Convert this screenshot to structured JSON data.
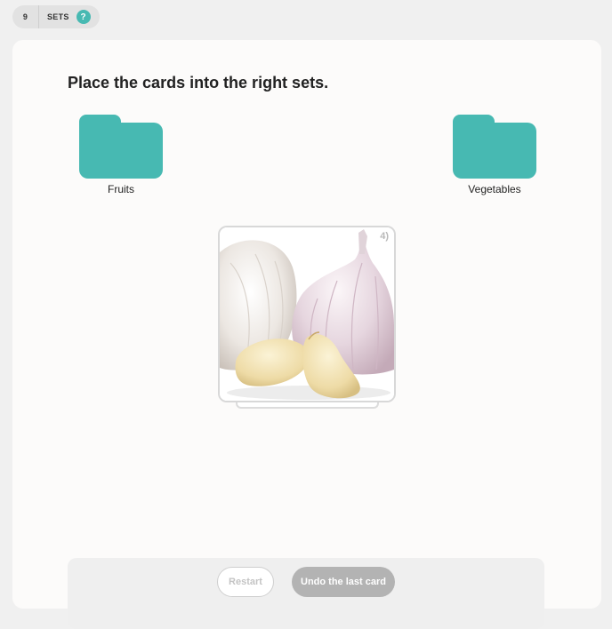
{
  "header": {
    "count": "9",
    "label": "SETS",
    "help_label": "?"
  },
  "main": {
    "instruction": "Place the cards into the right sets.",
    "sets": [
      {
        "label": "Fruits",
        "icon": "folder-icon"
      },
      {
        "label": "Vegetables",
        "icon": "folder-icon"
      }
    ],
    "card": {
      "counter": "4)",
      "image": "garlic-image"
    }
  },
  "footer": {
    "restart_label": "Restart",
    "undo_label": "Undo the last card"
  },
  "colors": {
    "accent": "#47b9b2",
    "page_background": "#f0f0f0",
    "panel_background": "#fcfbfa",
    "disabled_button": "#b3b3b3"
  }
}
